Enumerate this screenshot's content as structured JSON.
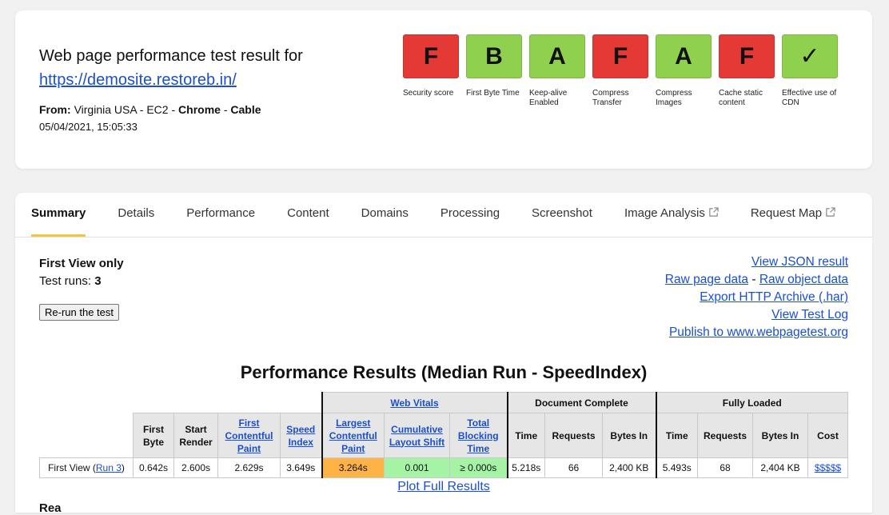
{
  "header": {
    "title": "Web page performance test result for",
    "url": "https://demosite.restoreb.in/",
    "from_label": "From:",
    "from_location": "Virginia USA - EC2",
    "sep1": "-",
    "browser": "Chrome",
    "sep2": "-",
    "connection": "Cable",
    "datetime": "05/04/2021, 15:05:33"
  },
  "grades": [
    {
      "grade": "F",
      "label": "Security score",
      "color": "#e53935"
    },
    {
      "grade": "B",
      "label": "First Byte Time",
      "color": "#8fd14f"
    },
    {
      "grade": "A",
      "label": "Keep-alive Enabled",
      "color": "#8fd14f"
    },
    {
      "grade": "F",
      "label": "Compress Transfer",
      "color": "#e53935"
    },
    {
      "grade": "A",
      "label": "Compress Images",
      "color": "#8fd14f"
    },
    {
      "grade": "F",
      "label": "Cache static content",
      "color": "#e53935"
    },
    {
      "grade": "✓",
      "label": "Effective use of CDN",
      "color": "#8fd14f"
    }
  ],
  "tabs": [
    {
      "label": "Summary",
      "active": true
    },
    {
      "label": "Details"
    },
    {
      "label": "Performance"
    },
    {
      "label": "Content"
    },
    {
      "label": "Domains"
    },
    {
      "label": "Processing"
    },
    {
      "label": "Screenshot"
    },
    {
      "label": "Image Analysis",
      "external": true
    },
    {
      "label": "Request Map",
      "external": true
    }
  ],
  "summary": {
    "first_view": "First View only",
    "runs_label": "Test runs:",
    "runs_value": "3",
    "rerun_button": "Re-run the test"
  },
  "links": {
    "json": "View JSON result",
    "raw_page": "Raw page data",
    "dash": "-",
    "raw_object": "Raw object data",
    "har": "Export HTTP Archive (.har)",
    "log": "View Test Log",
    "publish": "Publish to www.webpagetest.org"
  },
  "perf": {
    "title": "Performance Results (Median Run - SpeedIndex)",
    "group_web_vitals": "Web Vitals",
    "group_doc_complete": "Document Complete",
    "group_fully_loaded": "Fully Loaded",
    "headers": {
      "first_byte": "First Byte",
      "start_render": "Start Render",
      "fcp": "First Contentful Paint",
      "speed_index": "Speed Index",
      "lcp": "Largest Contentful Paint",
      "cls": "Cumulative Layout Shift",
      "tbt": "Total Blocking Time",
      "doc_time": "Time",
      "doc_requests": "Requests",
      "doc_bytes": "Bytes In",
      "full_time": "Time",
      "full_requests": "Requests",
      "full_bytes": "Bytes In",
      "cost": "Cost"
    },
    "row": {
      "label": "First View (",
      "run_link": "Run 3",
      "label_end": ")",
      "first_byte": "0.642s",
      "start_render": "2.600s",
      "fcp": "2.629s",
      "speed_index": "3.649s",
      "lcp": "3.264s",
      "cls": "0.001",
      "tbt": "≥ 0.000s",
      "doc_time": "5.218s",
      "doc_requests": "66",
      "doc_bytes": "2,400 KB",
      "full_time": "5.493s",
      "full_requests": "68",
      "full_bytes": "2,404 KB",
      "cost": "$$$$$"
    },
    "colors": {
      "lcp": "#ffb347",
      "good": "#a5f3a5"
    },
    "plot_link": "Plot Full Results",
    "results_peek": "Rea"
  }
}
